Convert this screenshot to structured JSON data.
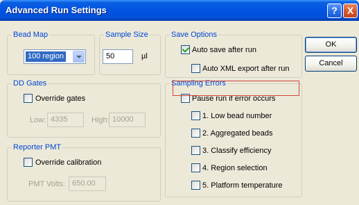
{
  "window": {
    "title": "Advanced Run Settings"
  },
  "titlebar_buttons": {
    "help": "?",
    "close": "X"
  },
  "bead_map": {
    "legend": "Bead Map",
    "selected": "100 region"
  },
  "sample_size": {
    "legend": "Sample Size",
    "value": "50",
    "unit": "µl"
  },
  "dd_gates": {
    "legend": "DD Gates",
    "override_label": "Override gates",
    "override_checked": false,
    "low_label": "Low:",
    "low_value": "4335",
    "high_label": "High:",
    "high_value": "10000"
  },
  "reporter_pmt": {
    "legend": "Reporter PMT",
    "override_label": "Override calibration",
    "override_checked": false,
    "volts_label": "PMT Volts:",
    "volts_value": "650.00"
  },
  "save_options": {
    "legend": "Save Options",
    "auto_save_label": "Auto save after run",
    "auto_save_checked": true,
    "auto_xml_label": "Auto XML export after run",
    "auto_xml_checked": false
  },
  "sampling_errors": {
    "legend": "Sampling Errors",
    "pause_label": "Pause run if error occurs",
    "pause_checked": false,
    "items": [
      {
        "label": "1. Low bead number",
        "checked": false
      },
      {
        "label": "2. Aggregated beads",
        "checked": false
      },
      {
        "label": "3. Classify efficiency",
        "checked": false
      },
      {
        "label": "4. Region selection",
        "checked": false
      },
      {
        "label": "5. Platform temperature",
        "checked": false
      }
    ]
  },
  "buttons": {
    "ok": "OK",
    "cancel": "Cancel"
  },
  "colors": {
    "highlight_box": "#d0463a",
    "group_legend": "#0046d5",
    "title_bar": "#0054e3"
  }
}
